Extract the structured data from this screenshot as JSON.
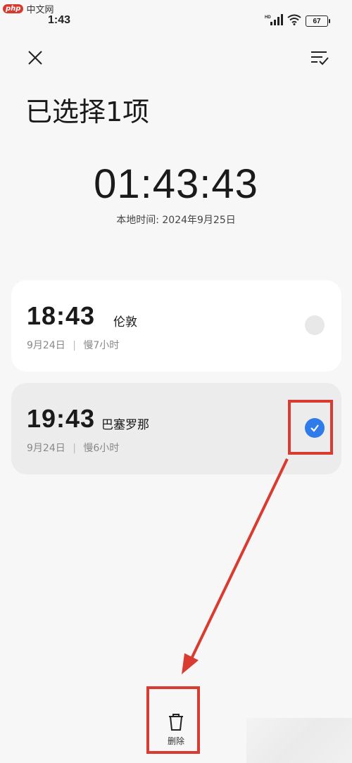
{
  "watermark": {
    "logo": "php",
    "text": "中文网"
  },
  "status_bar": {
    "time": "1:43",
    "battery": "67",
    "hd_label": "HD"
  },
  "header": {
    "title": "已选择1项"
  },
  "clock": {
    "time": "01:43:43",
    "local_date": "本地时间: 2024年9月25日"
  },
  "cards": [
    {
      "time": "18:43",
      "city": "伦敦",
      "date": "9月24日",
      "offset": "慢7小时",
      "selected": false
    },
    {
      "time": "19:43",
      "city": "巴塞罗那",
      "date": "9月24日",
      "offset": "慢6小时",
      "selected": true
    }
  ],
  "bottom_bar": {
    "delete_label": "删除"
  },
  "colors": {
    "accent": "#2f7bea",
    "highlight": "#d93b30",
    "background": "#f7f7f7"
  },
  "icons": {
    "close": "close-icon",
    "select_all": "checklist-icon",
    "delete": "trash-icon",
    "check": "check-icon"
  }
}
